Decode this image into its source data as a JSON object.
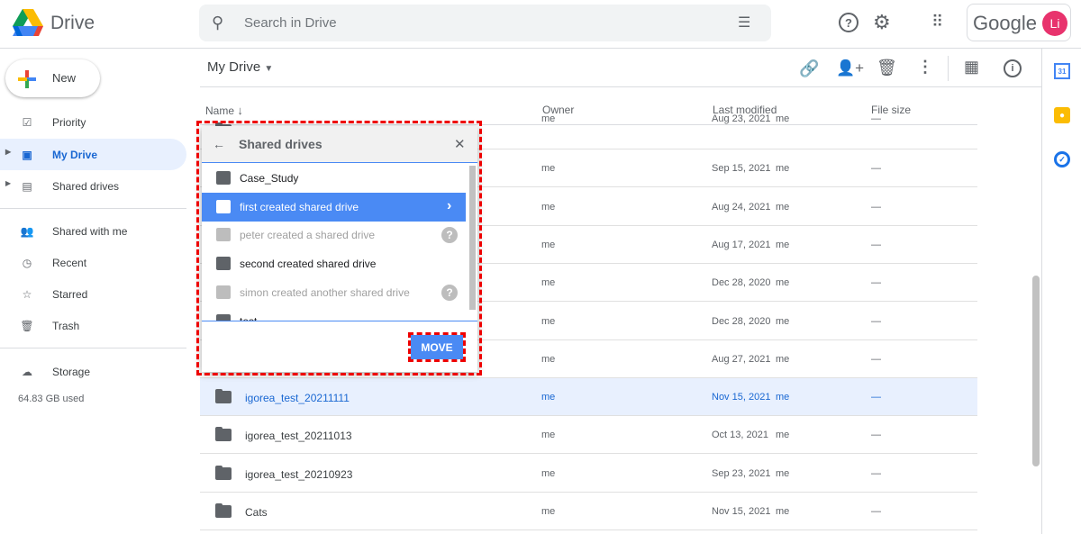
{
  "app": {
    "title": "Drive",
    "search_placeholder": "Search in Drive",
    "google_label": "Google",
    "avatar_initials": "Li"
  },
  "sidebar": {
    "new_label": "New",
    "items": [
      {
        "label": "Priority",
        "icon": "priority-icon"
      },
      {
        "label": "My Drive",
        "icon": "my-drive-icon",
        "active": true
      },
      {
        "label": "Shared drives",
        "icon": "shared-drives-icon"
      },
      {
        "label": "Shared with me",
        "icon": "people-icon"
      },
      {
        "label": "Recent",
        "icon": "clock-icon"
      },
      {
        "label": "Starred",
        "icon": "star-icon"
      },
      {
        "label": "Trash",
        "icon": "trash-icon"
      }
    ],
    "storage_label": "Storage",
    "storage_used": "64.83 GB used"
  },
  "main": {
    "title": "My Drive",
    "columns": {
      "name": "Name",
      "owner": "Owner",
      "modified": "Last modified",
      "size": "File size"
    },
    "rows": [
      {
        "name": "",
        "owner": "me",
        "modified": "Aug 23, 2021",
        "by": "me",
        "size": "—"
      },
      {
        "name": "",
        "owner": "me",
        "modified": "Sep 15, 2021",
        "by": "me",
        "size": "—"
      },
      {
        "name": "",
        "owner": "me",
        "modified": "Aug 24, 2021",
        "by": "me",
        "size": "—"
      },
      {
        "name": "",
        "owner": "me",
        "modified": "Aug 17, 2021",
        "by": "me",
        "size": "—"
      },
      {
        "name": "",
        "owner": "me",
        "modified": "Dec 28, 2020",
        "by": "me",
        "size": "—"
      },
      {
        "name": "",
        "owner": "me",
        "modified": "Dec 28, 2020",
        "by": "me",
        "size": "—"
      },
      {
        "name": "",
        "owner": "me",
        "modified": "Aug 27, 2021",
        "by": "me",
        "size": "—"
      },
      {
        "name": "igorea_test_20211111",
        "owner": "me",
        "modified": "Nov 15, 2021",
        "by": "me",
        "size": "—",
        "selected": true
      },
      {
        "name": "igorea_test_20211013",
        "owner": "me",
        "modified": "Oct 13, 2021",
        "by": "me",
        "size": "—"
      },
      {
        "name": "igorea_test_20210923",
        "owner": "me",
        "modified": "Sep 23, 2021",
        "by": "me",
        "size": "—"
      },
      {
        "name": "Cats",
        "owner": "me",
        "modified": "Nov 15, 2021",
        "by": "me",
        "size": "—"
      }
    ]
  },
  "dialog": {
    "title": "Shared drives",
    "move_label": "MOVE",
    "items": [
      {
        "label": "Case_Study"
      },
      {
        "label": "first created shared drive",
        "selected": true
      },
      {
        "label": "peter created a shared drive",
        "disabled": true
      },
      {
        "label": "second created shared drive"
      },
      {
        "label": "simon created another shared drive",
        "disabled": true
      },
      {
        "label": "test"
      }
    ]
  },
  "colors": {
    "accent": "#1a73e8",
    "selected_row": "#e8f0fe",
    "dialog_selected": "#4a8af4",
    "highlight": "#ee0000"
  }
}
